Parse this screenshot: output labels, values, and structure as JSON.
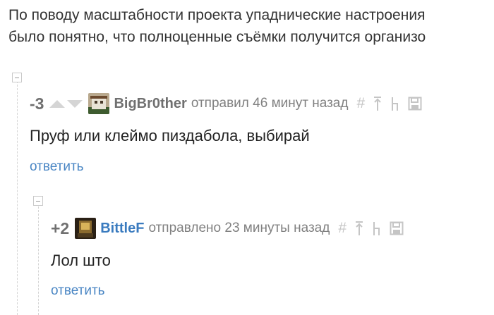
{
  "post": {
    "lines": [
      "По поводу масштабности проекта упаднические настроения",
      "было понятно, что полноценные съёмки получится организо"
    ]
  },
  "comments": [
    {
      "rating": "-3",
      "username": "BigBr0ther",
      "meta": "отправил 46 минут назад",
      "text": "Пруф или клеймо пиздабола, выбирай",
      "reply_label": "ответить",
      "username_color": "#707070"
    },
    {
      "rating": "+2",
      "username": "BittleF",
      "meta": "отправлено 23 минуты назад",
      "text": "Лол што",
      "reply_label": "ответить",
      "username_color": "#3a7bbf"
    }
  ],
  "tools": {
    "hash": "#",
    "up": "↑",
    "parent": "↳",
    "save": "save-icon"
  },
  "colors": {
    "link": "#4a86c4",
    "meta": "#808080",
    "icon": "#c5c5c5"
  }
}
